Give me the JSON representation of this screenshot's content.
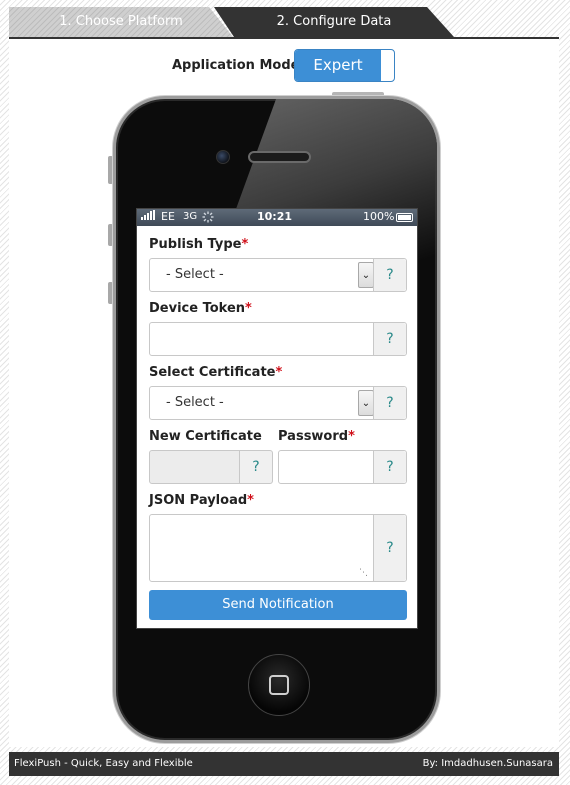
{
  "tabs": [
    {
      "label": "1. Choose Platform",
      "active": false
    },
    {
      "label": "2. Configure Data",
      "active": true
    }
  ],
  "app_mode": {
    "label": "Application Mode:",
    "value": "Expert"
  },
  "status_bar": {
    "carrier": "EE",
    "network": "3G",
    "time": "10:21",
    "battery": "100%"
  },
  "form": {
    "publish_type": {
      "label": "Publish Type",
      "required": "*",
      "selected": "- Select -",
      "help": "?"
    },
    "device_token": {
      "label": "Device Token",
      "required": "*",
      "value": "",
      "help": "?"
    },
    "select_certificate": {
      "label": "Select Certificate",
      "required": "*",
      "selected": "- Select -",
      "help": "?"
    },
    "new_certificate": {
      "label": "New Certificate",
      "value": "",
      "help": "?"
    },
    "password": {
      "label": "Password",
      "required": "*",
      "value": "",
      "help": "?"
    },
    "json_payload": {
      "label": "JSON Payload",
      "required": "*",
      "value": "",
      "help": "?"
    },
    "send_label": "Send Notification"
  },
  "footer": {
    "left": "FlexiPush - Quick, Easy and Flexible",
    "right": "By: Imdadhusen.Sunasara"
  },
  "colors": {
    "accent": "#3d8fd6",
    "required": "#d0101a",
    "dark": "#333333"
  }
}
